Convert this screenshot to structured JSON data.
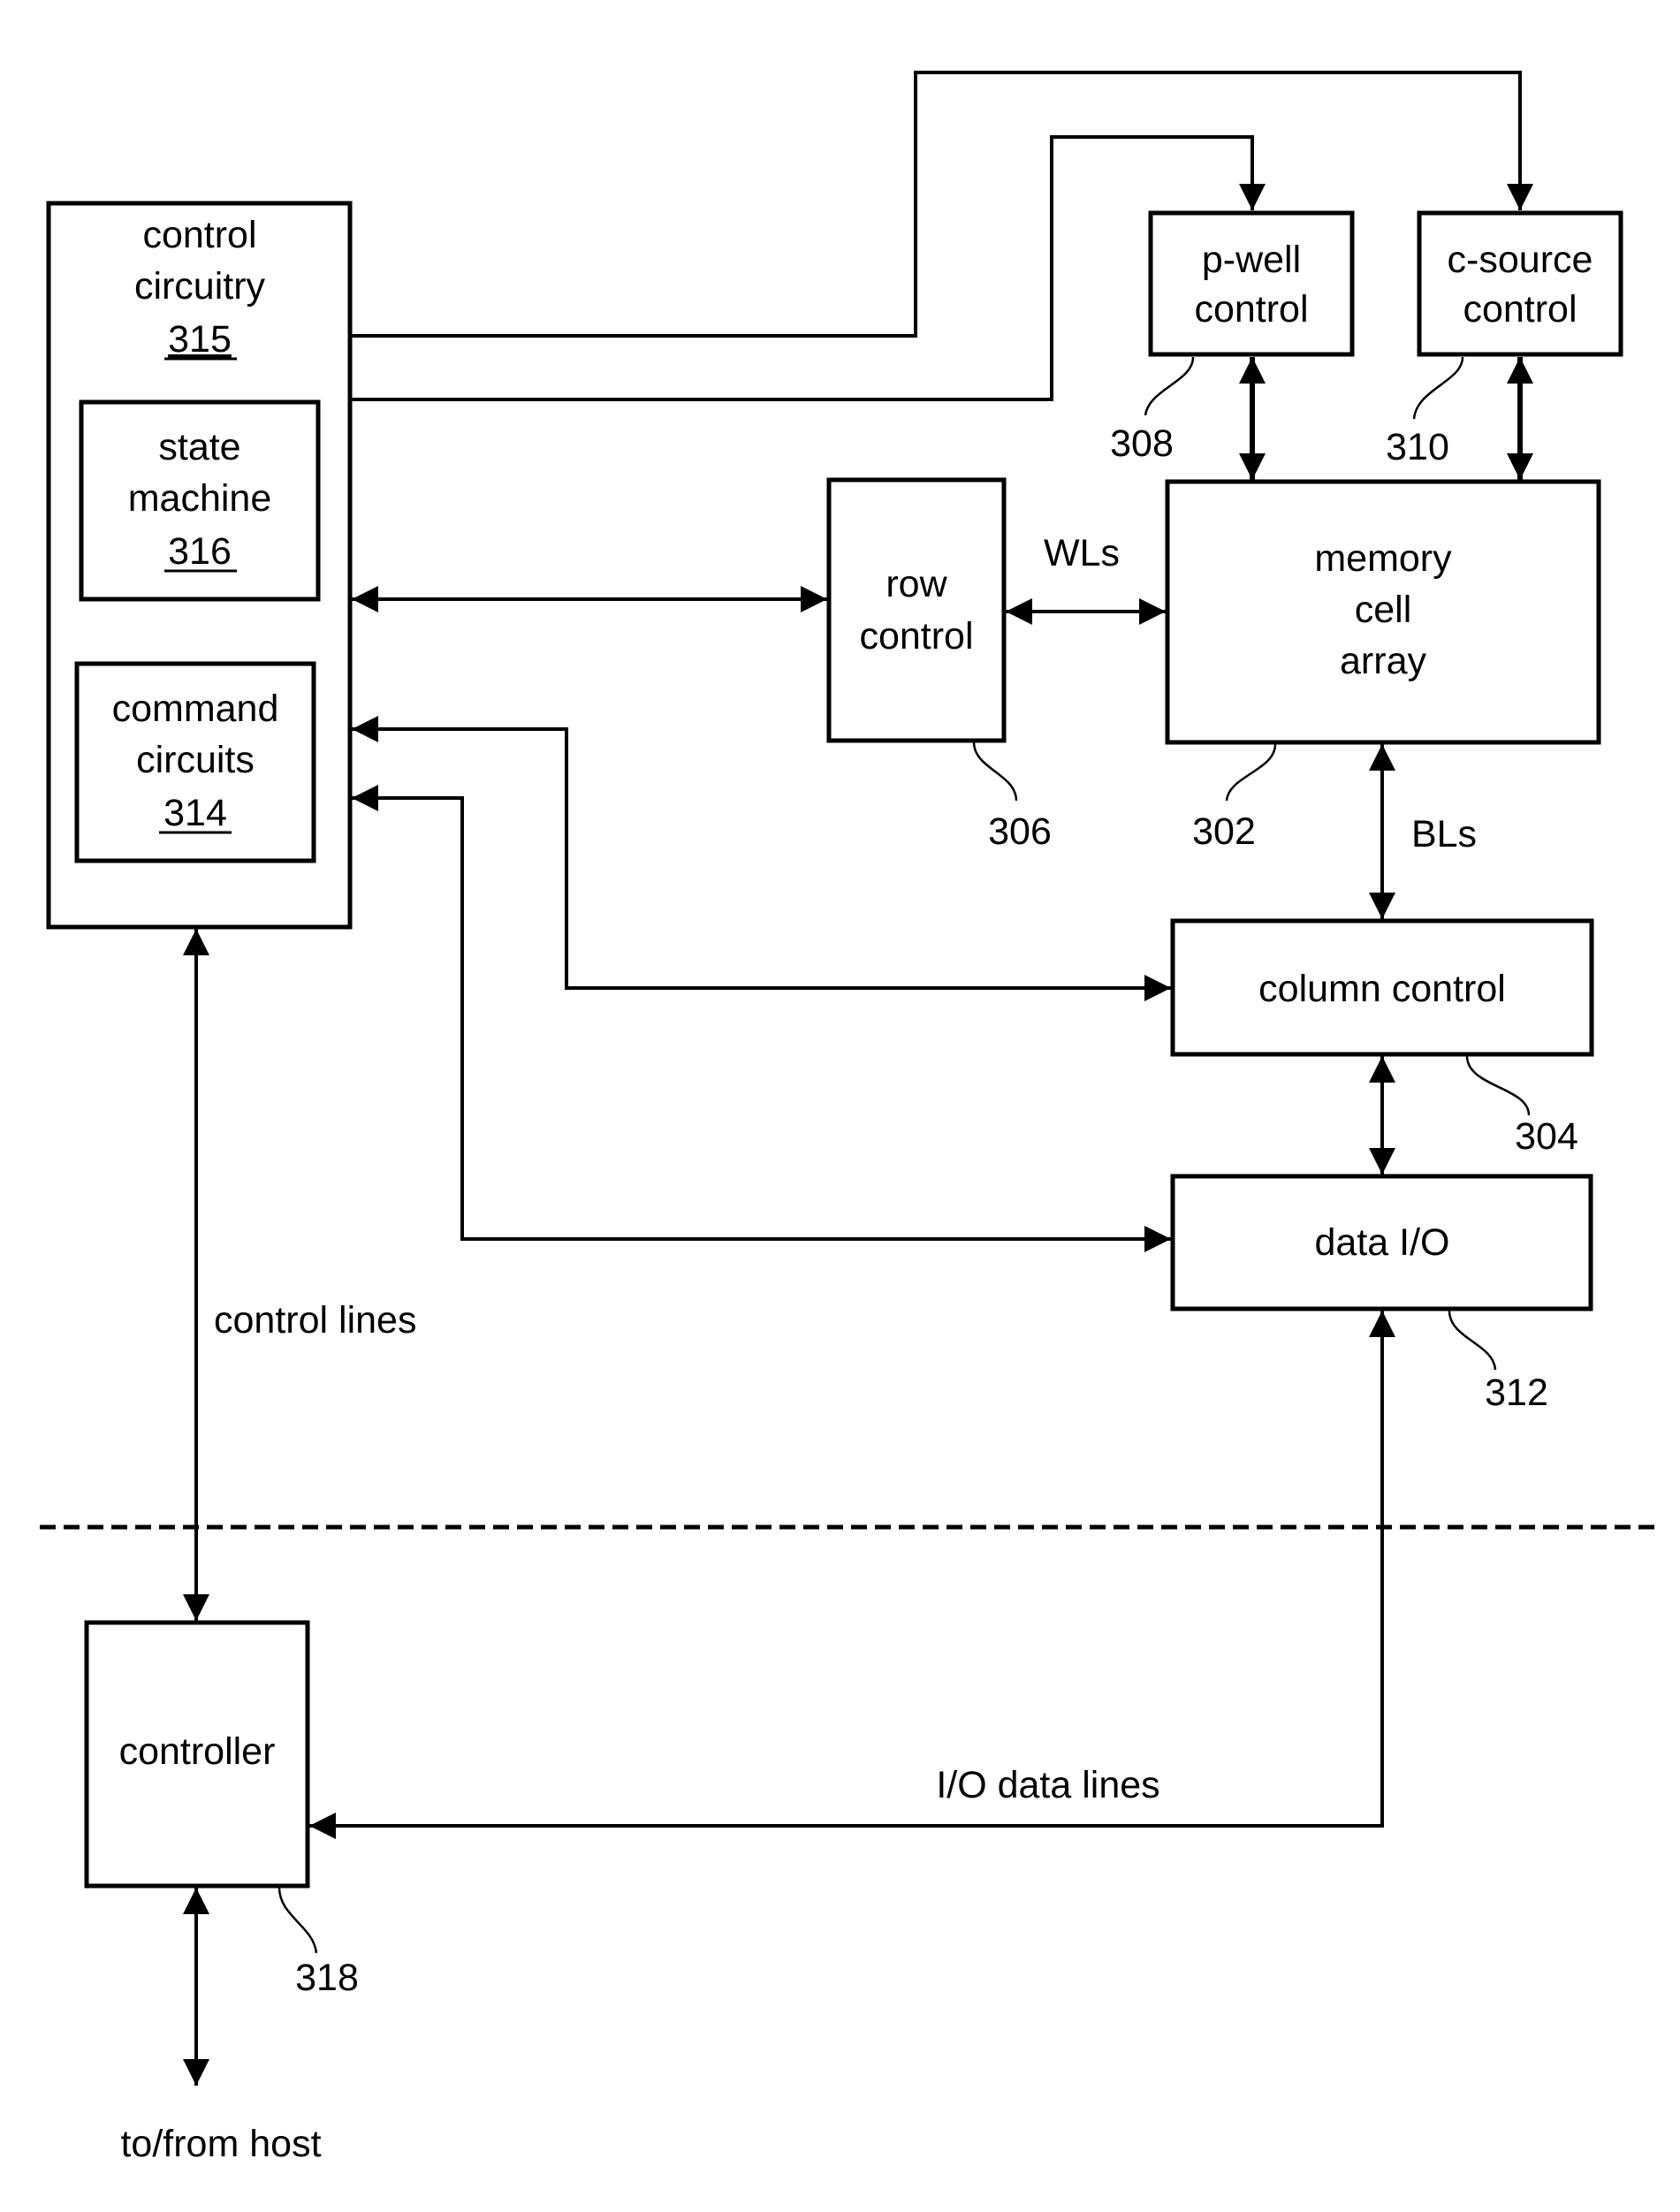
{
  "blocks": {
    "control_circuitry": {
      "lines": [
        "control",
        "circuitry"
      ],
      "ref": "315"
    },
    "state_machine": {
      "lines": [
        "state",
        "machine"
      ],
      "ref": "316"
    },
    "command_circuits": {
      "lines": [
        "command",
        "circuits"
      ],
      "ref": "314"
    },
    "p_well_control": {
      "lines": [
        "p-well",
        "control"
      ],
      "ref": "308"
    },
    "c_source_control": {
      "lines": [
        "c-source",
        "control"
      ],
      "ref": "310"
    },
    "row_control": {
      "lines": [
        "row",
        "control"
      ],
      "ref": "306"
    },
    "memory_cell_array": {
      "lines": [
        "memory",
        "cell",
        "array"
      ],
      "ref": "302"
    },
    "column_control": {
      "lines": [
        "column control"
      ],
      "ref": "304"
    },
    "data_io": {
      "lines": [
        "data I/O"
      ],
      "ref": "312"
    },
    "controller": {
      "lines": [
        "controller"
      ],
      "ref": "318"
    }
  },
  "signals": {
    "wls": "WLs",
    "bls": "BLs",
    "control_lines": "control lines",
    "io_data_lines": "I/O data lines",
    "host": "to/from host"
  }
}
